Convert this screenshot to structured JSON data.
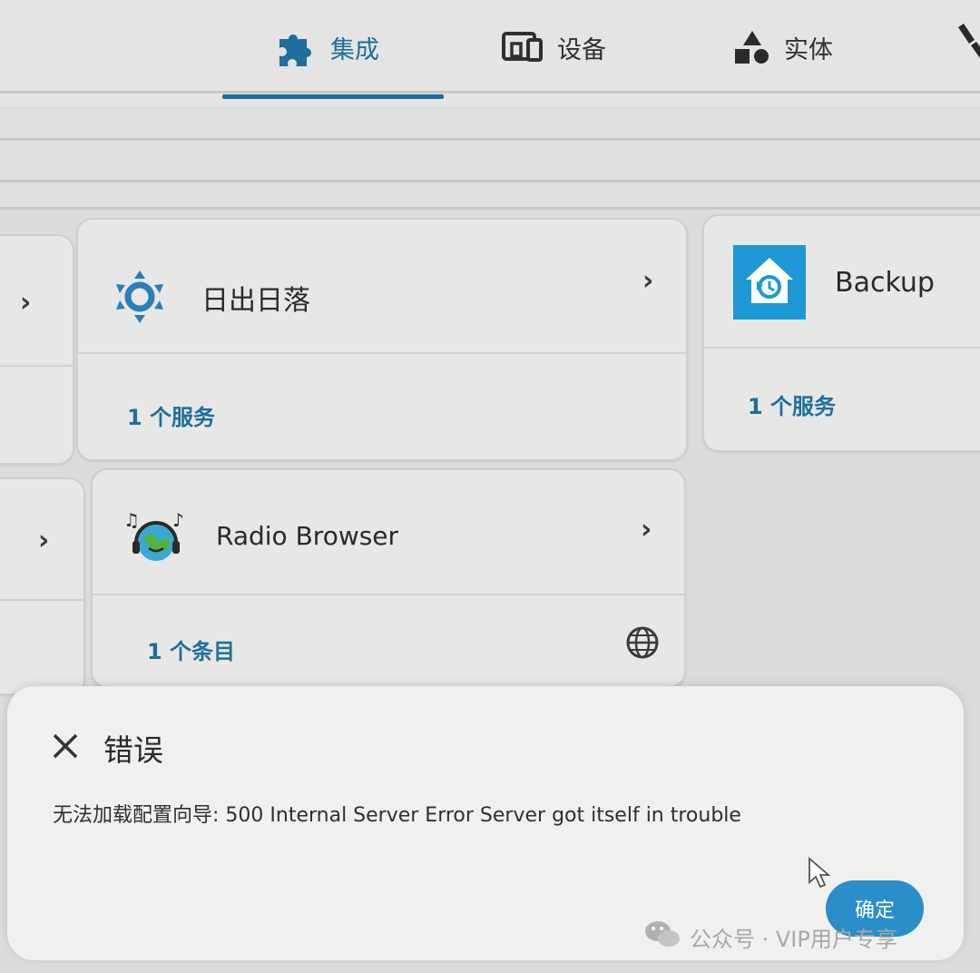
{
  "nav": {
    "tabs": [
      {
        "label": "集成",
        "icon": "puzzle-icon",
        "active": true
      },
      {
        "label": "设备",
        "icon": "devices-icon",
        "active": false
      },
      {
        "label": "实体",
        "icon": "shapes-icon",
        "active": false
      }
    ],
    "tools_icon": "wrench-icon"
  },
  "cards": [
    {
      "title": "日出日落",
      "subtitle": "1 个服务",
      "icon": "sun-icon"
    },
    {
      "title": "Backup",
      "subtitle": "1 个服务",
      "icon": "backup-icon"
    },
    {
      "title": "Radio Browser",
      "subtitle": "1 个条目",
      "icon": "radio-browser-icon"
    }
  ],
  "dialog": {
    "title": "错误",
    "message": "无法加载配置向导: 500 Internal Server Error Server got itself in trouble",
    "ok_label": "确定"
  },
  "watermark": "公众号 · VIP用户专享",
  "colors": {
    "accent": "#1f6e9c",
    "button": "#2a8fc8",
    "backup_tile": "#1e98d4"
  }
}
